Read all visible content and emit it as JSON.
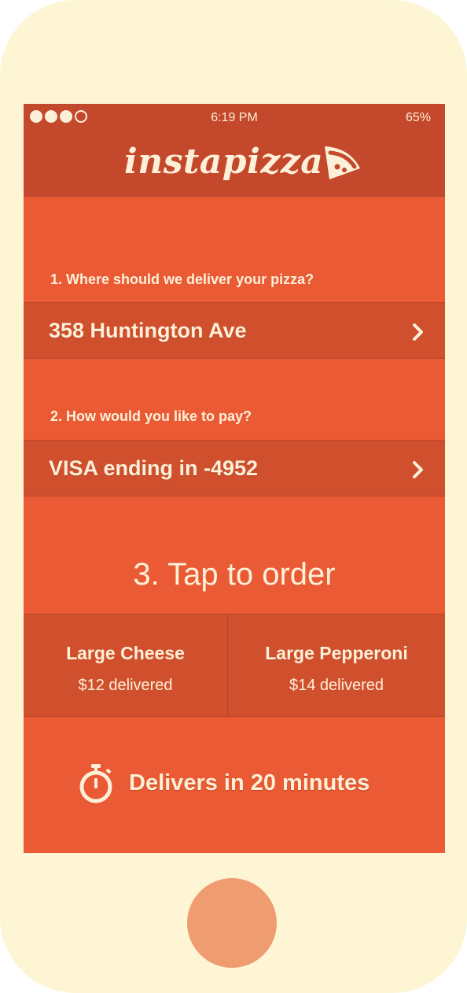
{
  "status_bar": {
    "time": "6:19 PM",
    "battery": "65%",
    "signal_bars": 3,
    "signal_max": 4
  },
  "header": {
    "logo_text": "instapizza",
    "logo_icon": "pizza-slice-icon"
  },
  "step1": {
    "question": "1. Where should we deliver your pizza?",
    "value": "358 Huntington Ave"
  },
  "step2": {
    "question": "2. How would you like to pay?",
    "value": "VISA ending in -4952"
  },
  "step3": {
    "title": "3. Tap to order"
  },
  "pizzas": [
    {
      "name": "Large Cheese",
      "price": "$12 delivered"
    },
    {
      "name": "Large Pepperoni",
      "price": "$14 delivered"
    }
  ],
  "delivery": {
    "text": "Delivers in 20 minutes",
    "icon": "stopwatch-icon"
  },
  "colors": {
    "background": "#ea5a34",
    "header": "#c4482b",
    "row": "#d0502e",
    "text": "#fdf0d8",
    "phone_body": "#fdf5d3",
    "home_button": "#ef9c70"
  }
}
